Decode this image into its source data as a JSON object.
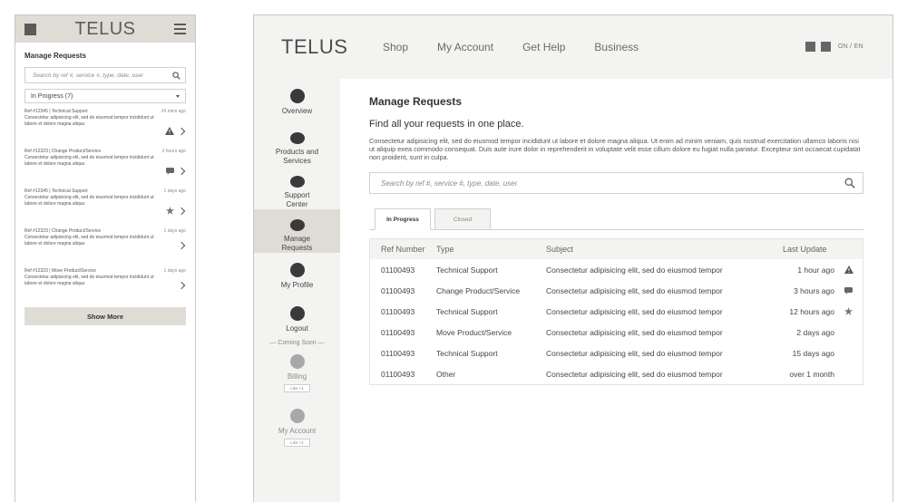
{
  "mobile": {
    "logo": "TELUS",
    "title": "Manage Requests",
    "search_placeholder": "Search by ref #, service #, type, date, user",
    "filter_value": "In Progress (7)",
    "items": [
      {
        "ref": "Ref #12345",
        "type": "Technical Support",
        "time": "24 mins ago",
        "text": "Consectetur adipisicing elit, sed do eiusmod tempor incididunt ut labore et dolore magna aliqua",
        "icon": "warning-icon"
      },
      {
        "ref": "Ref #12323",
        "type": "Change Product/Service",
        "time": "2 hours ago",
        "text": "Consectetur adipisicing elit, sed do eiusmod tempor incididunt ut labore et dolore magna aliqua",
        "icon": "chat-icon"
      },
      {
        "ref": "Ref #12345",
        "type": "Technical Support",
        "time": "1 days ago",
        "text": "Consectetur adipisicing elit, sed do eiusmod tempor incididunt ut labore et dolore magna aliqua",
        "icon": "star-icon"
      },
      {
        "ref": "Ref #12323",
        "type": "Change Product/Service",
        "time": "1 days ago",
        "text": "Consectetur adipisicing elit, sed do eiusmod tempor incididunt ut labore et dolore magna aliqua",
        "icon": ""
      },
      {
        "ref": "Ref #12323",
        "type": "Move Product/Service",
        "time": "1 days ago",
        "text": "Consectetur adipisicing elit, sed do eiusmod tempor incididunt ut labore et dolore magna aliqua",
        "icon": ""
      }
    ],
    "show_more": "Show More"
  },
  "desktop": {
    "logo": "TELUS",
    "nav": [
      "Shop",
      "My Account",
      "Get Help",
      "Business"
    ],
    "lang": "ON / EN",
    "sidebar": {
      "items": [
        {
          "label": "Overview"
        },
        {
          "label": "Products and Services"
        },
        {
          "label": "Support Center"
        },
        {
          "label": "Manage Requests"
        },
        {
          "label": "My Profile"
        },
        {
          "label": "Logout"
        }
      ],
      "coming_soon": "— Coming Soon —",
      "soon_items": [
        {
          "label": "Billing",
          "like": "Like +1"
        },
        {
          "label": "My Account",
          "like": "Like +1"
        }
      ]
    },
    "main": {
      "title": "Manage Requests",
      "subtitle": "Find all your requests in one place.",
      "body": "Consectetur adipisicing elit, sed do eiusmod tempor incididunt ut labore et dolore magna aliqua. Ut enim ad minim veniam, quis nostrud exercitation ullamco laboris nisi ut aliquip exea commodo consequat. Duis aute irure dolor in reprehenderit in voluptate velit esse cillum dolore eu fugiat nulla pariatur. Excepteur sint occaecat cupidatat non proident, sunt in culpa.",
      "search_placeholder": "Search by ref #, service #, type, date, user",
      "tabs": [
        "In Progress",
        "Closed"
      ],
      "table": {
        "headers": [
          "Ref Number",
          "Type",
          "Subject",
          "Last Update"
        ],
        "rows": [
          {
            "ref": "01100493",
            "type": "Technical Support",
            "subject": "Consectetur adipisicing elit, sed do eiusmod tempor",
            "update": "1 hour ago",
            "icon": "warning-icon"
          },
          {
            "ref": "01100493",
            "type": "Change Product/Service",
            "subject": "Consectetur adipisicing elit, sed do eiusmod tempor",
            "update": "3 hours ago",
            "icon": "chat-icon"
          },
          {
            "ref": "01100493",
            "type": "Technical Support",
            "subject": "Consectetur adipisicing elit, sed do eiusmod tempor",
            "update": "12 hours ago",
            "icon": "star-icon"
          },
          {
            "ref": "01100493",
            "type": "Move Product/Service",
            "subject": "Consectetur adipisicing elit, sed do eiusmod tempor",
            "update": "2 days ago",
            "icon": ""
          },
          {
            "ref": "01100493",
            "type": "Technical Support",
            "subject": "Consectetur adipisicing elit, sed do eiusmod tempor",
            "update": "15 days ago",
            "icon": ""
          },
          {
            "ref": "01100493",
            "type": "Other",
            "subject": "Consectetur adipisicing elit, sed do eiusmod tempor",
            "update": "over 1 month",
            "icon": ""
          }
        ]
      }
    }
  },
  "colors": {
    "header_bg": "#f3f3f1",
    "mobile_header_bg": "#dedcd5",
    "active_bg": "#dedcd5",
    "text_dark": "#333333",
    "icon_gray": "#666666"
  }
}
